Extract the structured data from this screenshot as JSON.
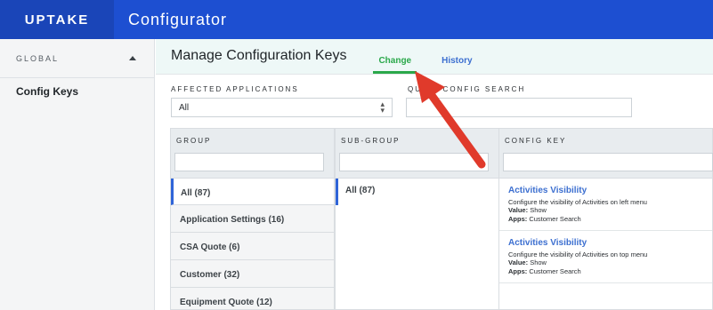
{
  "header": {
    "brand": "UPTAKE",
    "app_title": "Configurator"
  },
  "sidebar": {
    "section_label": "GLOBAL",
    "items": [
      {
        "label": "Config Keys"
      }
    ]
  },
  "main": {
    "title": "Manage Configuration Keys",
    "tabs": [
      {
        "label": "Change",
        "active": true
      },
      {
        "label": "History",
        "active": false
      }
    ],
    "filters": {
      "affected_apps_label": "AFFECTED APPLICATIONS",
      "affected_apps_value": "All",
      "quick_search_label": "QUICK CONFIG SEARCH",
      "quick_search_value": ""
    },
    "columns": {
      "group": "GROUP",
      "subgroup": "SUB-GROUP",
      "config_key": "CONFIG KEY"
    },
    "groups": [
      {
        "label": "All (87)",
        "selected": true
      },
      {
        "label": "Application Settings (16)"
      },
      {
        "label": "CSA Quote (6)"
      },
      {
        "label": "Customer (32)"
      },
      {
        "label": "Equipment Quote (12)"
      }
    ],
    "subgroups": [
      {
        "label": "All (87)",
        "selected": true
      }
    ],
    "config_keys": [
      {
        "title": "Activities Visibility",
        "description": "Configure the visibility of Activities on left menu",
        "value_label": "Value:",
        "value": "Show",
        "apps_label": "Apps:",
        "apps": "Customer Search"
      },
      {
        "title": "Activities Visibility",
        "description": "Configure the visibility of Activities on top menu",
        "value_label": "Value:",
        "value": "Show",
        "apps_label": "Apps:",
        "apps": "Customer Search"
      }
    ]
  },
  "colors": {
    "topbar": "#1d4fd1",
    "brand_bg": "#1a45b8",
    "active_tab": "#2aa84a",
    "link": "#3c6fd0",
    "selection_bar": "#2f64d8",
    "annotation_arrow": "#e03a2b"
  }
}
